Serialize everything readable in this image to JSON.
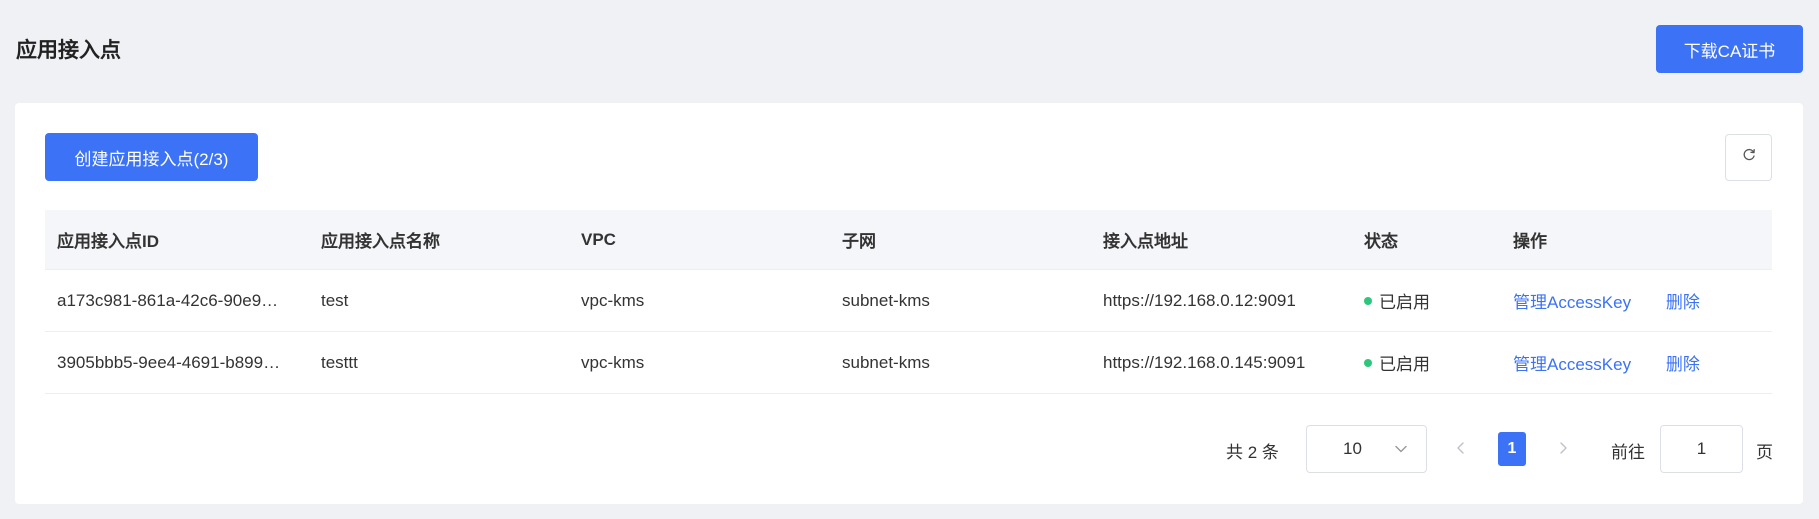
{
  "header": {
    "title": "应用接入点",
    "download_label": "下载CA证书"
  },
  "toolbar": {
    "create_label": "创建应用接入点(2/3)",
    "refresh_icon": "refresh-icon"
  },
  "table": {
    "columns": [
      "应用接入点ID",
      "应用接入点名称",
      "VPC",
      "子网",
      "接入点地址",
      "状态",
      "操作"
    ],
    "rows": [
      {
        "id": "a173c981-861a-42c6-90e9…",
        "name": "test",
        "vpc": "vpc-kms",
        "subnet": "subnet-kms",
        "address": "https://192.168.0.12:9091",
        "status": "已启用",
        "action_manage": "管理AccessKey",
        "action_delete": "删除"
      },
      {
        "id": "3905bbb5-9ee4-4691-b899…",
        "name": "testtt",
        "vpc": "vpc-kms",
        "subnet": "subnet-kms",
        "address": "https://192.168.0.145:9091",
        "status": "已启用",
        "action_manage": "管理AccessKey",
        "action_delete": "删除"
      }
    ]
  },
  "pagination": {
    "total_text": "共 2 条",
    "page_size": "10",
    "current_page": "1",
    "goto_label": "前往",
    "goto_value": "1",
    "page_suffix": "页"
  },
  "colors": {
    "primary": "#3b72f6",
    "status_enabled": "#2cc77c",
    "background": "#f0f1f5"
  }
}
